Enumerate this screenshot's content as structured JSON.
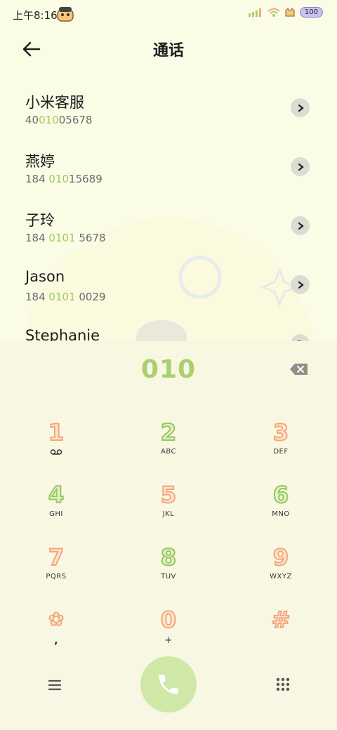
{
  "status": {
    "time": "上午8:16",
    "battery": "100",
    "icons": [
      "mascot-icon",
      "signal-icon",
      "wifi-icon",
      "cat-icon"
    ]
  },
  "header": {
    "title": "通话",
    "back_icon": "arrow-left-icon"
  },
  "contacts": [
    {
      "name": "小米客服",
      "num_pre": "40",
      "num_hl": "010",
      "num_post": "05678"
    },
    {
      "name": "燕婷",
      "num_pre": "184 ",
      "num_hl": "010",
      "num_post": "15689"
    },
    {
      "name": "子玲",
      "num_pre": "184 ",
      "num_hl": "0101",
      "num_post": " 5678"
    },
    {
      "name": "Jason",
      "num_pre": "184 ",
      "num_hl": "0101",
      "num_post": " 0029"
    },
    {
      "name": "Stephanie",
      "num_pre": "",
      "num_hl": "",
      "num_post": ""
    }
  ],
  "dialer": {
    "display": "010",
    "backspace_icon": "backspace-icon",
    "keys": [
      {
        "digit": "1",
        "letters": "",
        "green": false
      },
      {
        "digit": "2",
        "letters": "ABC",
        "green": true
      },
      {
        "digit": "3",
        "letters": "DEF",
        "green": false
      },
      {
        "digit": "4",
        "letters": "GHI",
        "green": true
      },
      {
        "digit": "5",
        "letters": "JKL",
        "green": false
      },
      {
        "digit": "6",
        "letters": "MNO",
        "green": true
      },
      {
        "digit": "7",
        "letters": "PQRS",
        "green": false
      },
      {
        "digit": "8",
        "letters": "TUV",
        "green": true
      },
      {
        "digit": "9",
        "letters": "WXYZ",
        "green": false
      },
      {
        "digit": "✿",
        "letters": ",",
        "green": false
      },
      {
        "digit": "0",
        "letters": "+",
        "green": false
      },
      {
        "digit": "#",
        "letters": "",
        "green": false
      }
    ]
  },
  "bottom": {
    "menu_icon": "menu-icon",
    "call_icon": "phone-icon",
    "keypad_icon": "keypad-icon"
  },
  "colors": {
    "background": "#fbfce6",
    "accent_green": "#a9cf72",
    "key_orange": "#f3a77c",
    "call_button": "#cfe8a8"
  }
}
